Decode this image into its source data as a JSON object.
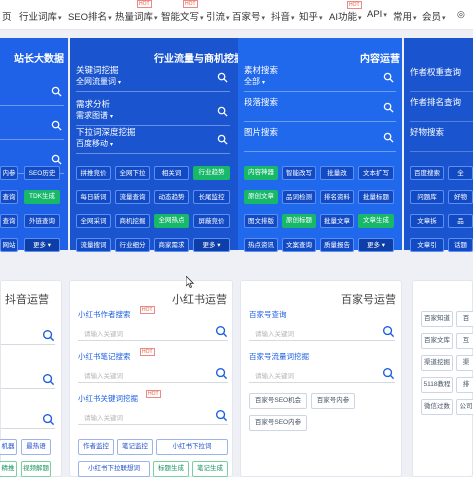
{
  "nav": {
    "items": [
      {
        "label": "页",
        "caret": false
      },
      {
        "label": "行业词库",
        "caret": true
      },
      {
        "label": "SEO排名",
        "caret": true
      },
      {
        "label": "热量词库",
        "caret": true
      },
      {
        "label": "智能文写",
        "caret": true
      },
      {
        "label": "引流",
        "caret": true
      },
      {
        "label": "百家号",
        "caret": true
      },
      {
        "label": "抖音",
        "caret": true
      },
      {
        "label": "知乎",
        "caret": true
      },
      {
        "label": "AI功能",
        "caret": true
      },
      {
        "label": "API",
        "caret": true
      },
      {
        "label": "常用",
        "caret": true
      },
      {
        "label": "会员",
        "caret": true
      }
    ],
    "hot_badge": "HOT"
  },
  "panels": {
    "p1": {
      "title": "站长大数据",
      "chips": [
        [
          "内参",
          "SEO历史"
        ],
        [
          "查询",
          "TDK生成"
        ],
        [
          "查询",
          "外链查询"
        ],
        [
          "网站",
          "更多"
        ]
      ]
    },
    "p2": {
      "title": "行业流量与商机挖掘",
      "fields": [
        {
          "label": "关键词挖掘",
          "select": "全网流量词"
        },
        {
          "label": "需求分析",
          "select": "需求图谱"
        },
        {
          "label": "下拉词深度挖掘",
          "select": "百度移动"
        }
      ],
      "chips": [
        [
          "拼推竞价",
          "全网下拉",
          "相关词",
          "行业趋势"
        ],
        [
          "每日新词",
          "流量查询",
          "动态趋势",
          "长尾监控"
        ],
        [
          "全网采词",
          "商机挖掘",
          "全网热点",
          "屏蔽竞价"
        ],
        [
          "流量搜词",
          "行业细分",
          "商家需求",
          "更多"
        ]
      ]
    },
    "p3": {
      "title": "内容运营",
      "fields": [
        {
          "label": "素材搜索",
          "select": "全部"
        },
        {
          "label": "段落搜索",
          "select": ""
        },
        {
          "label": "图片搜索",
          "select": ""
        }
      ],
      "chips": [
        [
          "内容神器",
          "智能改写",
          "批量改",
          "文本扩写"
        ],
        [
          "原创文章",
          "品词检测",
          "排名资料",
          "批量标题"
        ],
        [
          "图文排版",
          "原创标题",
          "批量文章",
          "文章生成"
        ],
        [
          "热点资讯",
          "文案查询",
          "质量报告",
          "更多"
        ]
      ]
    },
    "p4": {
      "fields": [
        {
          "label": "作者权重查询"
        },
        {
          "label": "作者排名查询"
        },
        {
          "label": "好物搜索"
        }
      ],
      "chips": [
        [
          "百度搜索",
          "全"
        ],
        [
          "问题库",
          "好物"
        ],
        [
          "文章拆",
          "品"
        ],
        [
          "文章引",
          "话题"
        ]
      ]
    }
  },
  "cards": {
    "douyin": {
      "title": "抖音运营",
      "tags": [
        [
          "机器",
          "最热语"
        ],
        [
          "精推",
          "视频解题"
        ]
      ]
    },
    "xhs": {
      "title": "小红书运营",
      "searches": [
        {
          "label": "小红书作者搜索",
          "placeholder": "请输入关键词"
        },
        {
          "label": "小红书笔记搜索",
          "placeholder": "请输入关键词"
        },
        {
          "label": "小红书关键词挖掘",
          "placeholder": "请输入关键词"
        }
      ],
      "tags": [
        "作者监控",
        "笔记监控",
        "小红书下拉词",
        "小红书下拉联想词",
        "标题生成",
        "笔记生成"
      ]
    },
    "baijia": {
      "title": "百家号运营",
      "searches": [
        {
          "label": "百家号查询",
          "placeholder": "请输入关键词"
        },
        {
          "label": "百家号流量词挖掘",
          "placeholder": "请输入关键词"
        }
      ],
      "tags": [
        "百家号SEO机会",
        "百家号内参",
        "百家号SEO内参"
      ]
    },
    "right": {
      "tags": [
        [
          "百家知道",
          "百"
        ],
        [
          "百家文库",
          "互"
        ],
        [
          "渠道挖掘",
          "渠"
        ],
        [
          "5118教程",
          "排"
        ],
        [
          "微信过数",
          "公司"
        ]
      ]
    }
  },
  "colors": {
    "accent": "#1f62e8",
    "green": "#17b86a",
    "link": "#1d5fe0"
  }
}
